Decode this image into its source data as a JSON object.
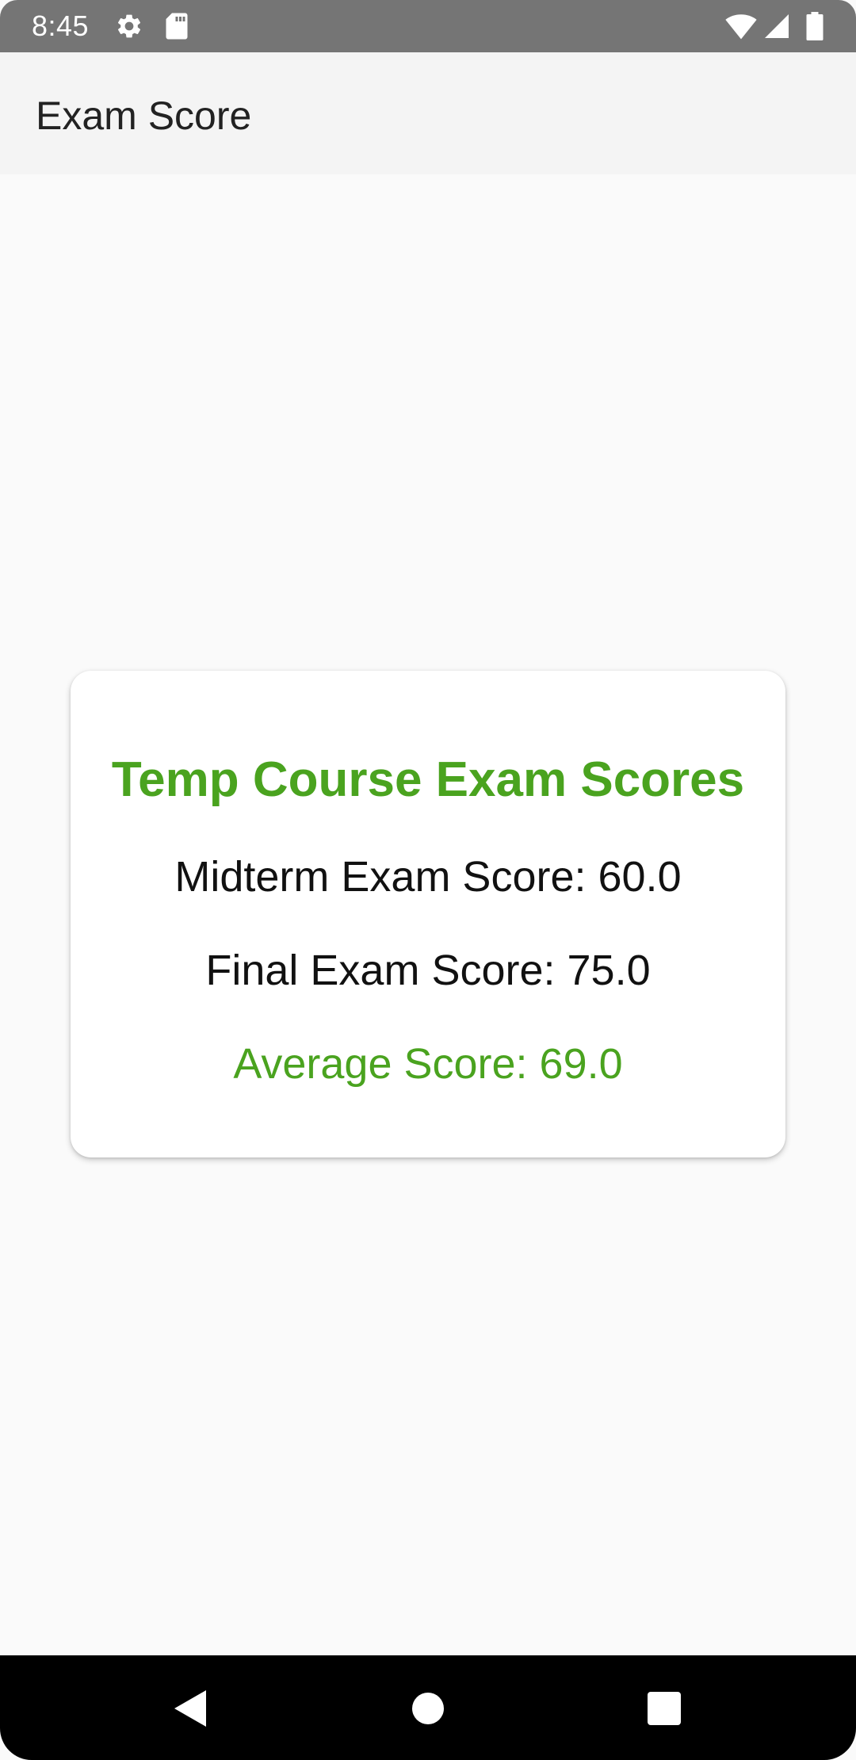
{
  "status_bar": {
    "time": "8:45",
    "icons": [
      "gear-icon",
      "sd-card-icon",
      "wifi-icon",
      "cell-signal-icon",
      "battery-icon"
    ]
  },
  "app_bar": {
    "title": "Exam Score"
  },
  "card": {
    "title": "Temp Course Exam Scores",
    "midterm": "Midterm Exam Score: 60.0",
    "final": "Final Exam Score: 75.0",
    "average": "Average Score: 69.0"
  },
  "navigation": {
    "icons": [
      "back-icon",
      "home-icon",
      "recents-icon"
    ]
  },
  "colors": {
    "accent": "#4aa31f",
    "status_bar": "#757575",
    "app_bar": "#f4f4f4",
    "background": "#fafafa",
    "nav_bar": "#000000"
  }
}
